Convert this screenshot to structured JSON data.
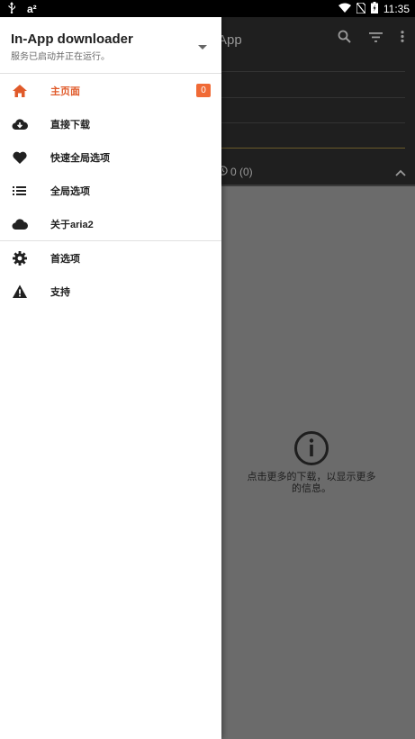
{
  "statusbar": {
    "time": "11:35",
    "app_indicator": "a²"
  },
  "app": {
    "title_visible": "App",
    "drawer_title": "In-App downloader",
    "drawer_subtitle": "服务已启动并正在运行。",
    "counts_label": "0 (0)"
  },
  "menu": {
    "items": [
      {
        "label": "主页面",
        "icon": "home-icon",
        "badge": "0",
        "active": true
      },
      {
        "label": "直接下载",
        "icon": "cloud-download-icon"
      },
      {
        "label": "快速全局选项",
        "icon": "heart-icon"
      },
      {
        "label": "全局选项",
        "icon": "list-icon"
      },
      {
        "label": "关于aria2",
        "icon": "cloud-icon"
      }
    ],
    "items2": [
      {
        "label": "首选项",
        "icon": "gear-icon"
      },
      {
        "label": "支持",
        "icon": "warning-icon"
      }
    ]
  },
  "empty_state": {
    "message": "点击更多的下载，以显示更多的信息。"
  },
  "colors": {
    "accent": "#e05a2a",
    "badge": "#f06a36",
    "drawer_bg": "#ffffff",
    "scrim": "#6b6b6b"
  }
}
